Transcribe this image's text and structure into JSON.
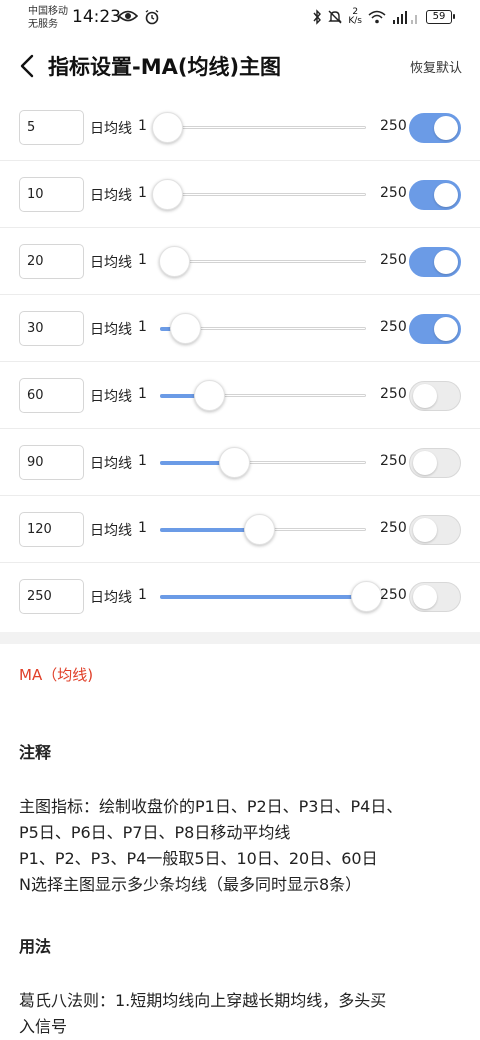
{
  "status_bar": {
    "carrier_line1": "中国移动",
    "carrier_line2": "无服务",
    "time": "14:23",
    "net_speed_value": "2",
    "net_speed_unit": "K/s",
    "battery": "59",
    "icons": [
      "eye-icon",
      "alarm-icon",
      "bluetooth-icon",
      "mute-icon",
      "wifi-icon",
      "signal-icon",
      "battery-icon"
    ]
  },
  "header": {
    "back_icon": "chevron-left-icon",
    "title": "指标设置-MA(均线)主图",
    "restore_label": "恢复默认"
  },
  "ma_rows": [
    {
      "days": "5",
      "label": "日均线",
      "min": "1",
      "max": "250",
      "value_fraction": 0.0,
      "enabled": true
    },
    {
      "days": "10",
      "label": "日均线",
      "min": "1",
      "max": "250",
      "value_fraction": 0.0,
      "enabled": true
    },
    {
      "days": "20",
      "label": "日均线",
      "min": "1",
      "max": "250",
      "value_fraction": 0.07,
      "enabled": true
    },
    {
      "days": "30",
      "label": "日均线",
      "min": "1",
      "max": "250",
      "value_fraction": 0.12,
      "enabled": true
    },
    {
      "days": "60",
      "label": "日均线",
      "min": "1",
      "max": "250",
      "value_fraction": 0.24,
      "enabled": false
    },
    {
      "days": "90",
      "label": "日均线",
      "min": "1",
      "max": "250",
      "value_fraction": 0.36,
      "enabled": false
    },
    {
      "days": "120",
      "label": "日均线",
      "min": "1",
      "max": "250",
      "value_fraction": 0.48,
      "enabled": false
    },
    {
      "days": "250",
      "label": "日均线",
      "min": "1",
      "max": "250",
      "value_fraction": 1.0,
      "enabled": false
    }
  ],
  "description": {
    "title": "MA（均线)",
    "notes_heading": "注释",
    "notes_lines": [
      "主图指标：绘制收盘价的P1日、P2日、P3日、P4日、",
      "P5日、P6日、P7日、P8日移动平均线",
      "P1、P2、P3、P4一般取5日、10日、20日、60日",
      "N选择主图显示多少条均线（最多同时显示8条）"
    ],
    "usage_heading": "用法",
    "usage_lines": [
      "葛氏八法则：1.短期均线向上穿越长期均线，多头买",
      "入信号"
    ]
  },
  "colors": {
    "accent": "#6b9be6",
    "title_red": "#e0402a",
    "band": "#f2f2f2"
  }
}
